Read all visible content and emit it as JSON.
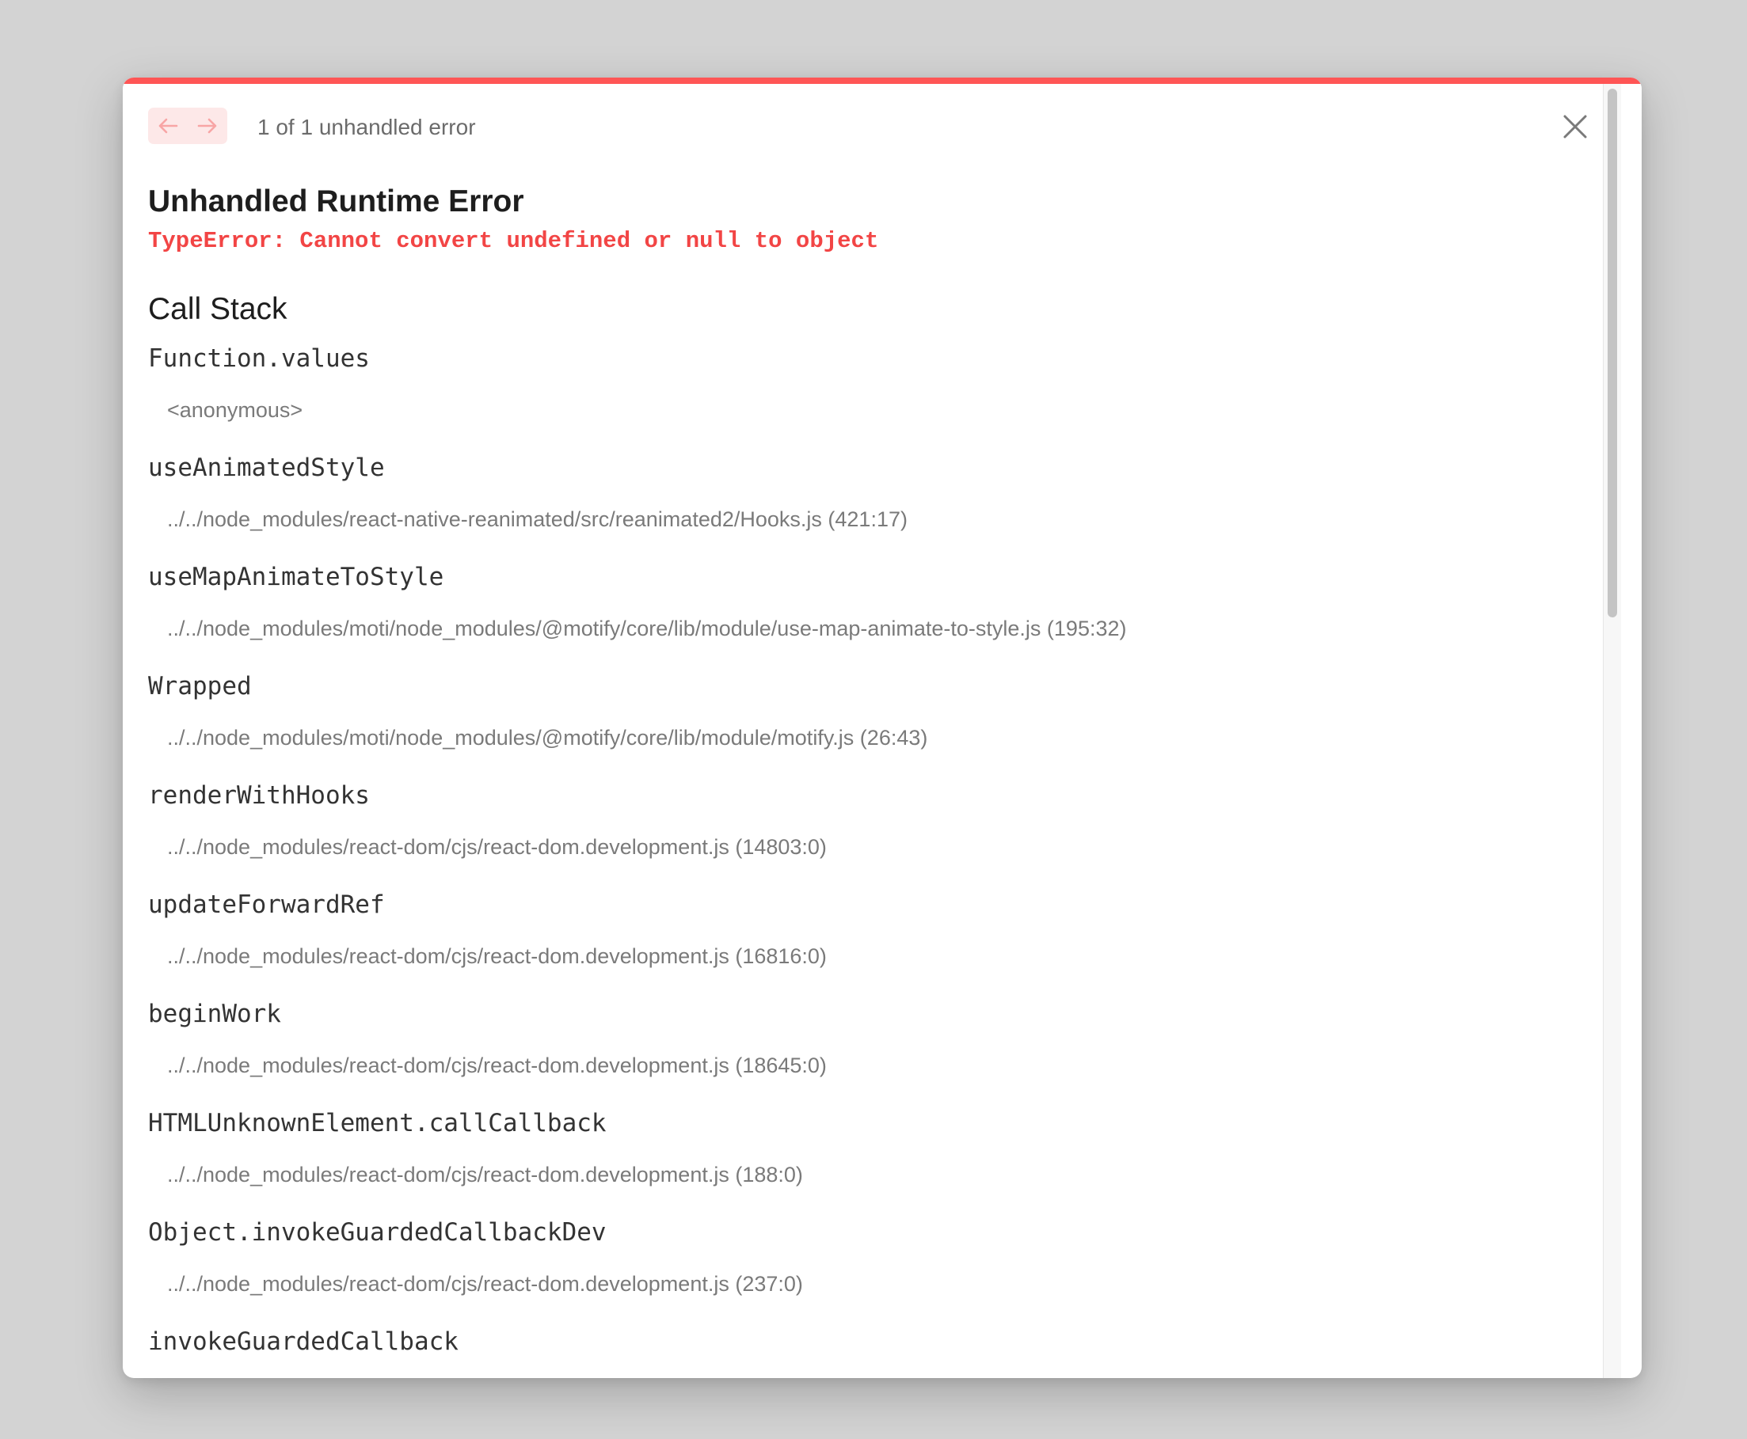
{
  "header": {
    "prev_icon": "arrow-left-icon",
    "next_icon": "arrow-right-icon",
    "count_text": "1 of 1 unhandled error",
    "close_icon": "close-icon"
  },
  "error": {
    "title": "Unhandled Runtime Error",
    "message": "TypeError: Cannot convert undefined or null to object"
  },
  "call_stack": {
    "title": "Call Stack",
    "frames": [
      {
        "fn": "Function.values",
        "loc": "<anonymous>"
      },
      {
        "fn": "useAnimatedStyle",
        "loc": "../../node_modules/react-native-reanimated/src/reanimated2/Hooks.js (421:17)"
      },
      {
        "fn": "useMapAnimateToStyle",
        "loc": "../../node_modules/moti/node_modules/@motify/core/lib/module/use-map-animate-to-style.js (195:32)"
      },
      {
        "fn": "Wrapped",
        "loc": "../../node_modules/moti/node_modules/@motify/core/lib/module/motify.js (26:43)"
      },
      {
        "fn": "renderWithHooks",
        "loc": "../../node_modules/react-dom/cjs/react-dom.development.js (14803:0)"
      },
      {
        "fn": "updateForwardRef",
        "loc": "../../node_modules/react-dom/cjs/react-dom.development.js (16816:0)"
      },
      {
        "fn": "beginWork",
        "loc": "../../node_modules/react-dom/cjs/react-dom.development.js (18645:0)"
      },
      {
        "fn": "HTMLUnknownElement.callCallback",
        "loc": "../../node_modules/react-dom/cjs/react-dom.development.js (188:0)"
      },
      {
        "fn": "Object.invokeGuardedCallbackDev",
        "loc": "../../node_modules/react-dom/cjs/react-dom.development.js (237:0)"
      },
      {
        "fn": "invokeGuardedCallback",
        "loc": ""
      }
    ]
  },
  "colors": {
    "accent": "#ff5555",
    "error_text": "#f24545",
    "nav_bg": "#fde8e8",
    "backdrop": "#d3d3d3"
  }
}
